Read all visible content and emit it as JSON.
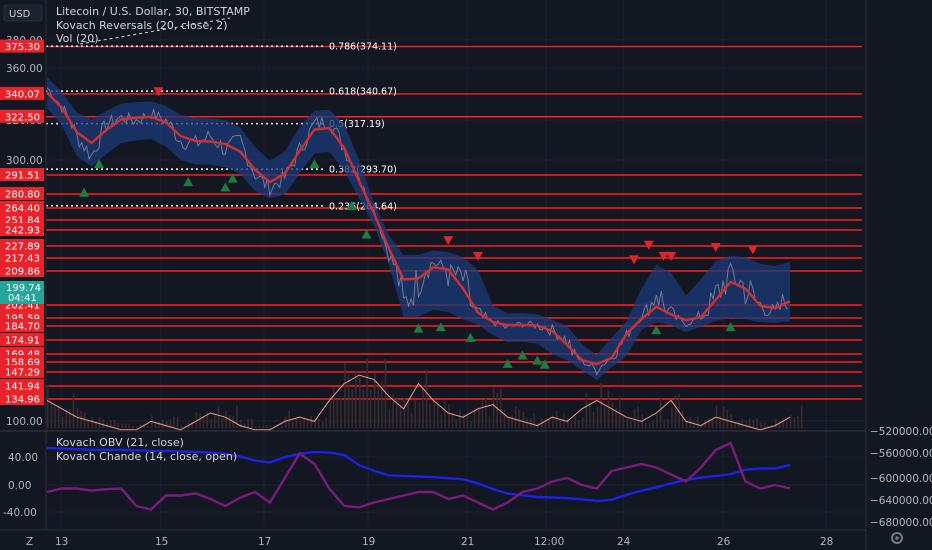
{
  "header": {
    "currency_button": "USD",
    "chart_title": "Litecoin / U.S. Dollar, 30, BITSTAMP",
    "indicator_1": "Kovach Reversals (20, close, 2)",
    "indicator_2": "Vol (20)",
    "logo_letter": "Z"
  },
  "colors": {
    "background": "#131722",
    "level_line": "#ff1f1f",
    "level_tag": "#e8232b",
    "price_tag": "#26a69a",
    "band_fill": "#1c3a78",
    "ma_line": "#d32f2f",
    "up_marker": "#1b7d3f",
    "down_marker": "#e0262b",
    "obv": "#1e22e6",
    "chande": "#7b1b7d"
  },
  "chart_data": [
    {
      "type": "line",
      "title": "Litecoin / U.S. Dollar, 30, BITSTAMP",
      "x_ticks": [
        "13",
        "15",
        "17",
        "19",
        "21",
        "12:00",
        "24",
        "26",
        "28"
      ],
      "y_ticks": [
        380,
        360,
        340,
        320,
        300,
        100
      ],
      "ylim": [
        95,
        385
      ],
      "current_price": "199.74",
      "countdown": "04:41",
      "levels": [
        375.3,
        340.07,
        322.5,
        291.51,
        280.8,
        264.4,
        251.84,
        242.93,
        227.89,
        217.43,
        209.86,
        202.41,
        195.59,
        184.7,
        174.91,
        169.48,
        158.69,
        147.29,
        141.94,
        134.96
      ],
      "fib_levels": [
        {
          "label": "0.786(374.11)",
          "value": 374.11
        },
        {
          "label": "0.618(340.67)",
          "value": 340.67
        },
        {
          "label": "0.5(317.19)",
          "value": 317.19
        },
        {
          "label": "0.382(293.70)",
          "value": 293.7
        },
        {
          "label": "0.236(264.64)",
          "value": 264.64
        }
      ],
      "x": [
        0,
        2,
        4,
        6,
        8,
        10,
        12,
        14,
        16,
        18,
        20,
        22,
        24,
        26,
        28,
        30,
        32,
        34,
        36,
        38,
        40,
        42,
        44,
        46,
        48,
        50,
        52,
        54,
        56,
        58,
        60,
        62,
        64,
        66,
        68,
        70,
        72,
        74,
        76,
        78,
        80,
        82,
        84,
        86,
        88,
        90,
        92,
        94,
        96,
        98,
        100
      ],
      "close": [
        345,
        330,
        312,
        302,
        318,
        322,
        320,
        325,
        320,
        310,
        308,
        312,
        305,
        310,
        292,
        284,
        290,
        305,
        318,
        320,
        306,
        292,
        262,
        220,
        202,
        208,
        215,
        210,
        208,
        198,
        190,
        183,
        188,
        186,
        182,
        175,
        160,
        150,
        165,
        178,
        196,
        206,
        198,
        188,
        196,
        204,
        210,
        206,
        202,
        198,
        205
      ],
      "volume": [
        108,
        106,
        104,
        103,
        102,
        101,
        101,
        103,
        102,
        101,
        103,
        105,
        104,
        102,
        101,
        101,
        103,
        104,
        103,
        108,
        112,
        114,
        113,
        109,
        106,
        112,
        108,
        105,
        104,
        106,
        107,
        104,
        103,
        102,
        104,
        103,
        106,
        108,
        106,
        104,
        103,
        105,
        108,
        103,
        102,
        104,
        103,
        102,
        101,
        102,
        104
      ],
      "up_markers": [
        5,
        7,
        19,
        24,
        25,
        36,
        41,
        43,
        50,
        53,
        57,
        62,
        64,
        66,
        67,
        82,
        92
      ],
      "down_markers": [
        15,
        54,
        58,
        79,
        81,
        83,
        84,
        90,
        95
      ]
    },
    {
      "type": "line",
      "legend": [
        "Kovach OBV (21, close)",
        "Kovach Chande (14, close, open)"
      ],
      "y_ticks_left": [
        "40.00",
        "0.00",
        "-40.00"
      ],
      "y_ticks_right": [
        "−520000.00",
        "−560000.00",
        "−600000.00",
        "−640000.00",
        "−680000.00"
      ],
      "obv": [
        -550000,
        -551000,
        -552000,
        -553000,
        -553000,
        -553000,
        -554000,
        -555000,
        -555000,
        -556000,
        -557000,
        -558000,
        -560000,
        -565000,
        -572000,
        -575000,
        -566000,
        -560000,
        -557000,
        -558000,
        -562000,
        -580000,
        -590000,
        -598000,
        -599000,
        -600000,
        -601000,
        -603000,
        -605000,
        -612000,
        -622000,
        -630000,
        -633000,
        -636000,
        -637000,
        -638000,
        -640000,
        -643000,
        -641000,
        -632000,
        -625000,
        -619000,
        -612000,
        -606000,
        -602000,
        -599000,
        -596000,
        -588000,
        -586000,
        -586000,
        -580000
      ],
      "chande": [
        -10,
        -5,
        -5,
        -8,
        -6,
        -5,
        -30,
        -35,
        -15,
        -15,
        -12,
        -20,
        -30,
        -18,
        -10,
        -25,
        10,
        45,
        30,
        -5,
        -30,
        -32,
        -25,
        -20,
        -15,
        -10,
        -10,
        -20,
        -15,
        -25,
        -35,
        -25,
        -10,
        -5,
        5,
        10,
        0,
        -5,
        20,
        25,
        30,
        25,
        15,
        5,
        25,
        50,
        60,
        5,
        -5,
        0,
        -5
      ]
    }
  ]
}
